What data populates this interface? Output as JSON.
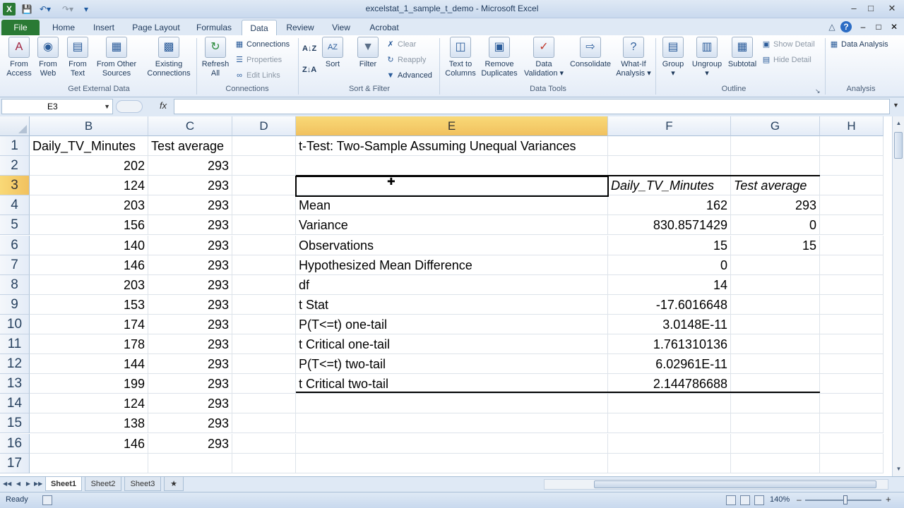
{
  "window": {
    "title": "excelstat_1_sample_t_demo - Microsoft Excel"
  },
  "tabs": [
    {
      "label": "File"
    },
    {
      "label": "Home"
    },
    {
      "label": "Insert"
    },
    {
      "label": "Page Layout"
    },
    {
      "label": "Formulas"
    },
    {
      "label": "Data"
    },
    {
      "label": "Review"
    },
    {
      "label": "View"
    },
    {
      "label": "Acrobat"
    }
  ],
  "ribbon": {
    "get_external": {
      "from_access": "From Access",
      "from_web": "From Web",
      "from_text": "From Text",
      "from_other": "From Other Sources",
      "existing": "Existing Connections",
      "group_label": "Get External Data"
    },
    "connections": {
      "refresh": "Refresh All",
      "connections": "Connections",
      "properties": "Properties",
      "edit_links": "Edit Links",
      "group_label": "Connections"
    },
    "sort_filter": {
      "sort": "Sort",
      "filter": "Filter",
      "clear": "Clear",
      "reapply": "Reapply",
      "advanced": "Advanced",
      "group_label": "Sort & Filter"
    },
    "data_tools": {
      "text_to_columns": "Text to Columns",
      "remove_duplicates": "Remove Duplicates",
      "data_validation": "Data Validation",
      "consolidate": "Consolidate",
      "what_if": "What-If Analysis",
      "group_label": "Data Tools"
    },
    "outline": {
      "group": "Group",
      "ungroup": "Ungroup",
      "subtotal": "Subtotal",
      "show_detail": "Show Detail",
      "hide_detail": "Hide Detail",
      "group_label": "Outline"
    },
    "analysis": {
      "data_analysis": "Data Analysis",
      "group_label": "Analysis"
    }
  },
  "formula_bar": {
    "name_box": "E3",
    "fx": "fx",
    "formula": ""
  },
  "grid": {
    "columns": [
      "B",
      "C",
      "D",
      "E",
      "F",
      "G",
      "H"
    ],
    "rows": [
      "1",
      "2",
      "3",
      "4",
      "5",
      "6",
      "7",
      "8",
      "9",
      "10",
      "11",
      "12",
      "13",
      "14",
      "15",
      "16",
      "17"
    ],
    "col_b_header": "Daily_TV_Minutes",
    "col_c_header": "Test average",
    "col_b": [
      202,
      124,
      203,
      156,
      140,
      146,
      203,
      153,
      174,
      178,
      144,
      199,
      124,
      138,
      146
    ],
    "col_c": [
      293,
      293,
      293,
      293,
      293,
      293,
      293,
      293,
      293,
      293,
      293,
      293,
      293,
      293,
      293
    ],
    "ttest": {
      "title": "t-Test: Two-Sample Assuming Unequal Variances",
      "header_f": "Daily_TV_Minutes",
      "header_g": "Test average",
      "labels": [
        "Mean",
        "Variance",
        "Observations",
        "Hypothesized Mean Difference",
        "df",
        "t Stat",
        "P(T<=t) one-tail",
        "t Critical one-tail",
        "P(T<=t) two-tail",
        "t Critical two-tail"
      ],
      "f_values": [
        "162",
        "830.8571429",
        "15",
        "0",
        "14",
        "-17.6016648",
        "3.0148E-11",
        "1.761310136",
        "6.02961E-11",
        "2.144786688"
      ],
      "g_values": [
        "293",
        "0",
        "15",
        "",
        "",
        "",
        "",
        "",
        "",
        ""
      ]
    }
  },
  "sheets": [
    "Sheet1",
    "Sheet2",
    "Sheet3"
  ],
  "status": {
    "ready": "Ready",
    "zoom": "140%"
  }
}
